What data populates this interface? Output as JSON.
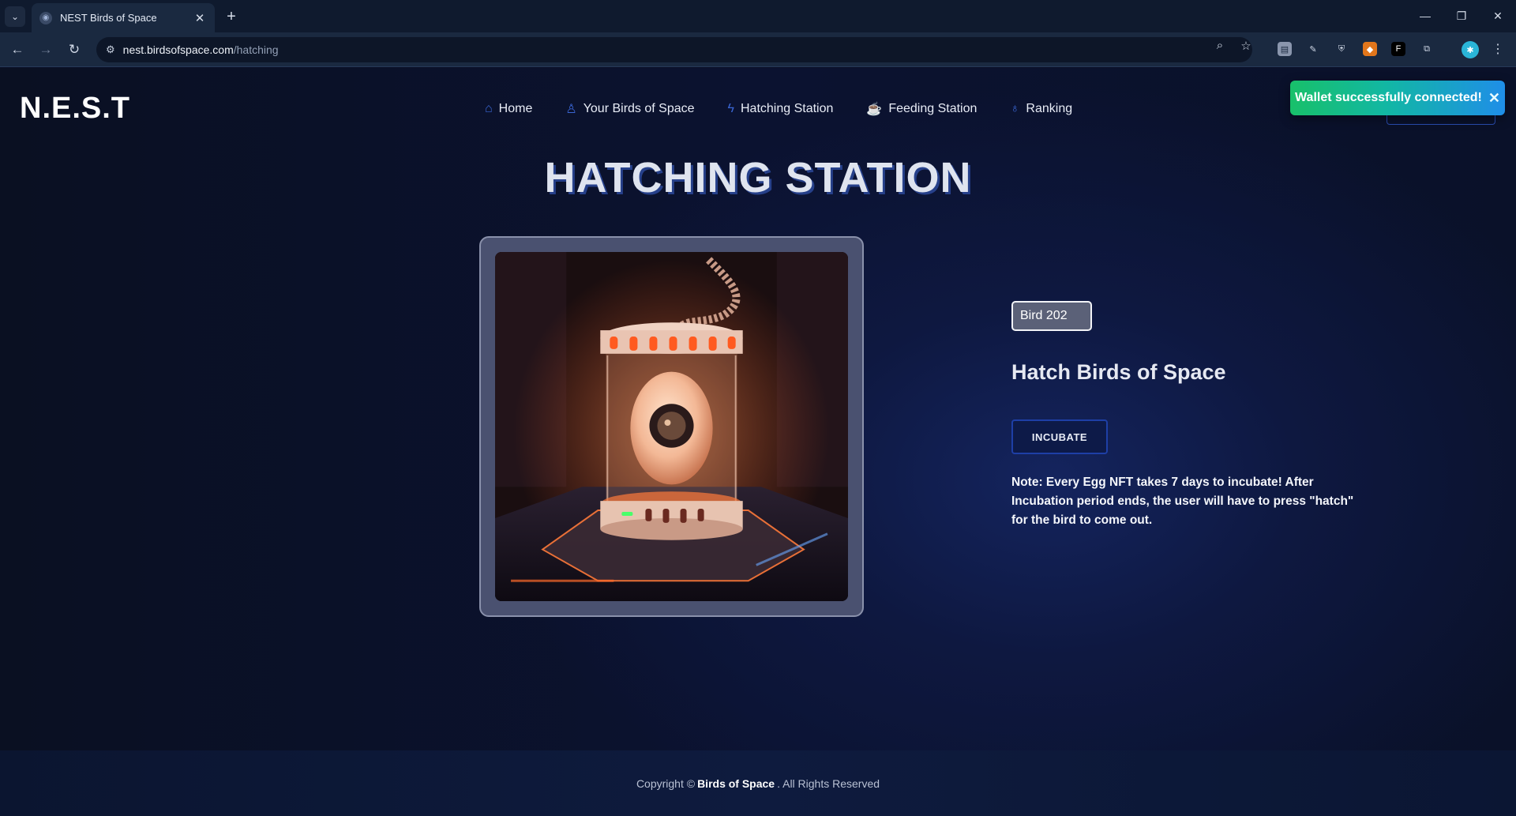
{
  "browser": {
    "tab_title": "NEST Birds of Space",
    "tab_close": "✕",
    "new_tab": "+",
    "url_host": "nest.birdsofspace.com",
    "url_path": "/hatching",
    "window_controls": {
      "minimize": "—",
      "restore": "❐",
      "close": "✕"
    }
  },
  "site": {
    "logo": "N.E.S.T",
    "nav": [
      {
        "label": "Home",
        "icon": "home-icon"
      },
      {
        "label": "Your Birds of Space",
        "icon": "user-icon"
      },
      {
        "label": "Hatching Station",
        "icon": "bolt-icon"
      },
      {
        "label": "Feeding Station",
        "icon": "cup-icon"
      },
      {
        "label": "Ranking",
        "icon": "medal-icon"
      }
    ],
    "toast": {
      "message": "Wallet successfully connected!",
      "close": "✕"
    }
  },
  "main": {
    "heading": "HATCHING STATION",
    "bird_select": {
      "value": "Bird 202"
    },
    "hatch_title": "Hatch Birds of Space",
    "incubate_label": "INCUBATE",
    "note": "Note: Every Egg NFT takes 7 days to incubate! After Incubation period ends, the user will have to press \"hatch\" for the bird to come out."
  },
  "footer": {
    "prefix": "Copyright ©",
    "brand": "Birds of Space",
    "suffix": ". All Rights Reserved"
  },
  "colors": {
    "accent": "#1e3fa6",
    "toast_start": "#18c06a",
    "toast_end": "#1f8ee8"
  }
}
